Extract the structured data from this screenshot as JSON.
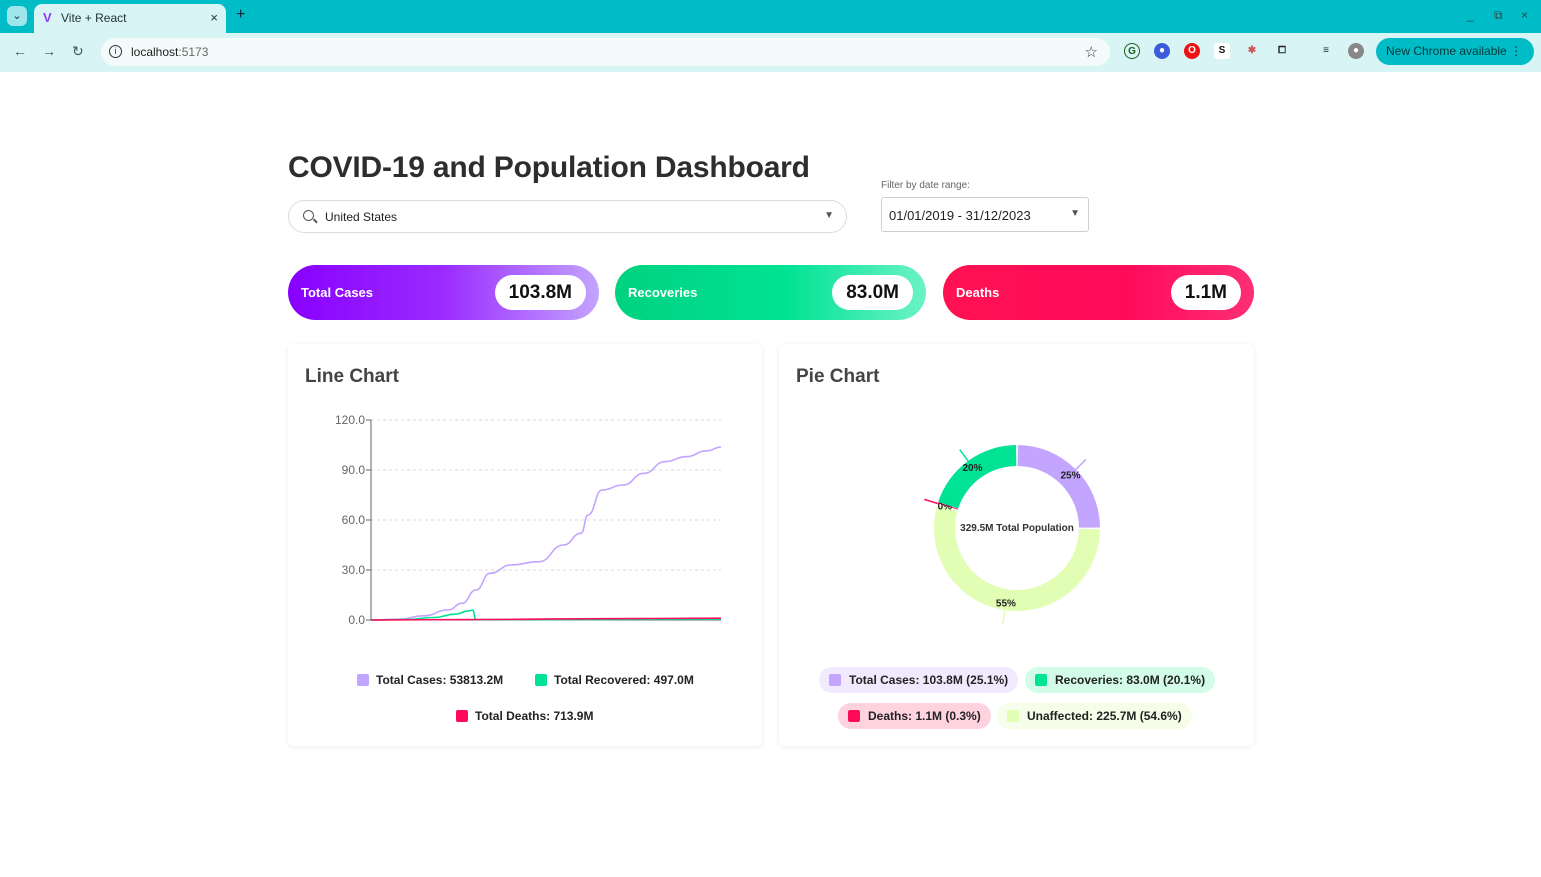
{
  "browser": {
    "tab_title": "Vite + React",
    "url_host": "localhost",
    "url_port": ":5173",
    "update_label": "New Chrome available",
    "extensions": [
      "S"
    ]
  },
  "header": {
    "title": "COVID-19 and Population Dashboard",
    "country_value": "United States",
    "filter_label": "Filter by date range:",
    "date_range": "01/01/2019 - 31/12/2023"
  },
  "stats": {
    "total_cases_label": "Total Cases",
    "total_cases_value": "103.8M",
    "recoveries_label": "Recoveries",
    "recoveries_value": "83.0M",
    "deaths_label": "Deaths",
    "deaths_value": "1.1M"
  },
  "line_card": {
    "title": "Line Chart",
    "legend_cases": "Total Cases: 53813.2M",
    "legend_recovered": "Total Recovered: 497.0M",
    "legend_deaths": "Total Deaths: 713.9M"
  },
  "pie_card": {
    "title": "Pie Chart",
    "center_label": "329.5M Total Population",
    "legend_cases": "Total Cases: 103.8M (25.1%)",
    "legend_recoveries": "Recoveries: 83.0M (20.1%)",
    "legend_deaths": "Deaths: 1.1M (0.3%)",
    "legend_unaffected": "Unaffected: 225.7M (54.6%)"
  },
  "colors": {
    "cases": "#c3a4ff",
    "recovered": "#00e294",
    "deaths": "#ff0b5c",
    "unaffected": "#e2fdb4"
  },
  "chart_data": [
    {
      "type": "line",
      "title": "Line Chart",
      "ylim": [
        0,
        120
      ],
      "yticks": [
        "0.0",
        "30.0",
        "60.0",
        "90.0",
        "120.0"
      ],
      "series": [
        {
          "name": "Total Cases",
          "x": [
            0,
            0.08,
            0.15,
            0.22,
            0.26,
            0.3,
            0.34,
            0.4,
            0.48,
            0.55,
            0.6,
            0.62,
            0.66,
            0.72,
            0.78,
            0.84,
            0.9,
            0.96,
            1.0
          ],
          "values": [
            0,
            0.5,
            2.5,
            6,
            10,
            18,
            28,
            33,
            35,
            45,
            52,
            63,
            78,
            81,
            88,
            95,
            98,
            101.5,
            103.8
          ]
        },
        {
          "name": "Total Recovered",
          "x": [
            0,
            0.1,
            0.18,
            0.24,
            0.28,
            0.29,
            0.3,
            1.0
          ],
          "values": [
            0,
            0.3,
            1.5,
            3.5,
            5.5,
            6,
            0.2,
            0.5
          ]
        },
        {
          "name": "Total Deaths",
          "x": [
            0,
            0.3,
            0.6,
            1.0
          ],
          "values": [
            0,
            0.3,
            0.7,
            1.1
          ]
        }
      ]
    },
    {
      "type": "pie",
      "title": "Pie Chart",
      "center_label": "329.5M Total Population",
      "slices": [
        {
          "name": "Total Cases",
          "value": 25.1,
          "label": "25%"
        },
        {
          "name": "Unaffected",
          "value": 54.6,
          "label": "55%"
        },
        {
          "name": "Deaths",
          "value": 0.3,
          "label": "0%"
        },
        {
          "name": "Recoveries",
          "value": 20.1,
          "label": "20%"
        }
      ]
    }
  ]
}
